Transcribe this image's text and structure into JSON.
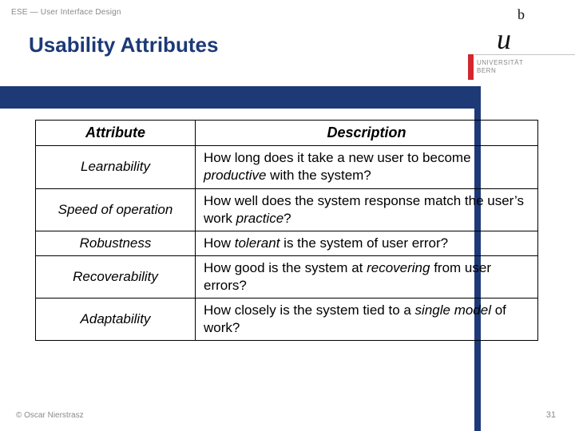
{
  "breadcrumb": "ESE — User Interface Design",
  "title": "Usability Attributes",
  "logo": {
    "u": "u",
    "b": "b",
    "line1": "UNIVERSITÄT",
    "line2": "BERN"
  },
  "table": {
    "header_attr": "Attribute",
    "header_desc": "Description",
    "rows": [
      {
        "attr": "Learnability",
        "desc_pre": "How long does it take a new user to become ",
        "desc_em": "productive",
        "desc_post": " with the system?"
      },
      {
        "attr": "Speed of operation",
        "desc_pre": "How well does the system response match the user’s work ",
        "desc_em": "practice",
        "desc_post": "?"
      },
      {
        "attr": "Robustness",
        "desc_pre": "How ",
        "desc_em": "tolerant",
        "desc_post": " is the system of user error?"
      },
      {
        "attr": "Recoverability",
        "desc_pre": "How good is the system at ",
        "desc_em": "recovering",
        "desc_post": " from user errors?"
      },
      {
        "attr": "Adaptability",
        "desc_pre": "How closely is the system tied to a ",
        "desc_em": "single model",
        "desc_post": " of work?"
      }
    ]
  },
  "footer": "© Oscar Nierstrasz",
  "page_number": "31"
}
